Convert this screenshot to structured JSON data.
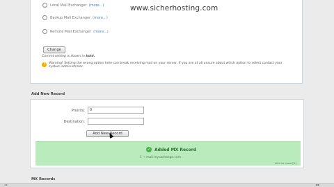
{
  "watermark": "www.sicherhosting.com",
  "mx_routing": {
    "options": [
      {
        "label": "Local Mail Exchanger",
        "more": "(more...)"
      },
      {
        "label": "Backup Mail Exchanger",
        "more": "(more...)"
      },
      {
        "label": "Remote Mail Exchanger",
        "more": "(more...)"
      }
    ],
    "change_button": "Change",
    "current_setting_prefix": "Current setting is shown in",
    "current_setting_bold": "bold.",
    "warning_text": "Warning! Setting the wrong option here can break receiving mail on your server. If you are at all unsure about which option to select contact your system administrator."
  },
  "add_new_record": {
    "title": "Add New Record",
    "priority_label": "Priority:",
    "priority_value": "0",
    "destination_label": "Destination:",
    "destination_value": "",
    "add_button": "Add New Record",
    "success_title": "Added MX Record",
    "success_detail": "1 → mail.mycashange.com",
    "close_link": "click to close [X]"
  },
  "mx_records": {
    "title": "MX Records"
  },
  "colors": {
    "success_bg": "#b9ebbd",
    "success_text": "#2d6e2e",
    "warning_icon": "#e6b400"
  }
}
